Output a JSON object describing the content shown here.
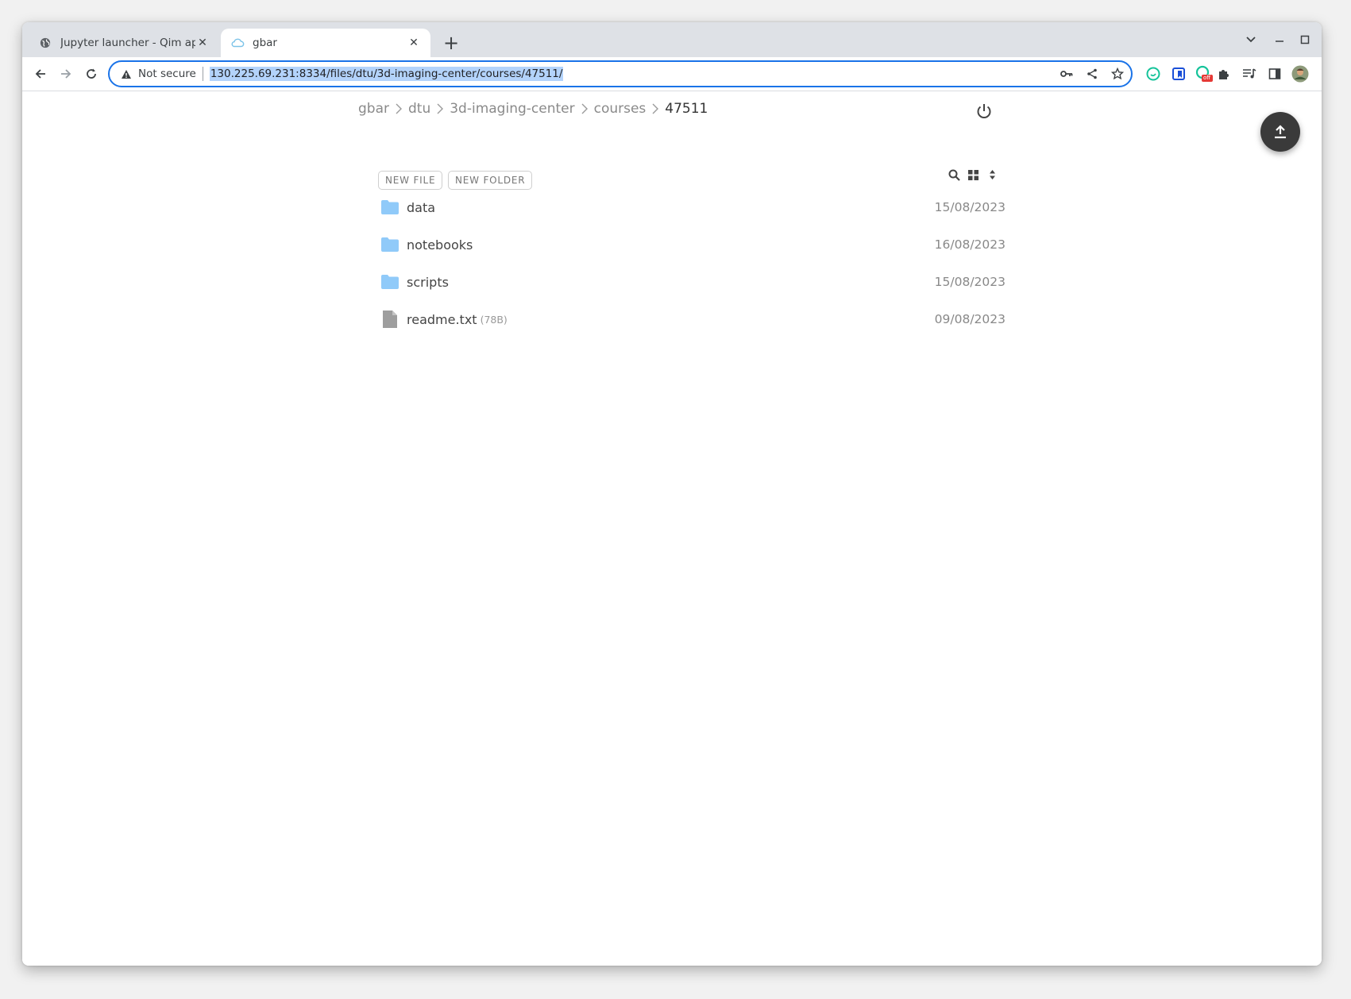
{
  "browser": {
    "tabs": [
      {
        "title": "Jupyter launcher - Qim app",
        "active": false,
        "favicon": "globe-icon"
      },
      {
        "title": "gbar",
        "active": true,
        "favicon": "cloud-icon"
      }
    ],
    "address": {
      "security_label": "Not secure",
      "url": "130.225.69.231:8334/files/dtu/3d-imaging-center/courses/47511/"
    },
    "extension_badge": "off"
  },
  "breadcrumb": [
    "gbar",
    "dtu",
    "3d-imaging-center",
    "courses",
    "47511"
  ],
  "actions": {
    "new_file": "NEW FILE",
    "new_folder": "NEW FOLDER"
  },
  "files": [
    {
      "name": "data",
      "type": "folder",
      "size": "",
      "date": "15/08/2023"
    },
    {
      "name": "notebooks",
      "type": "folder",
      "size": "",
      "date": "16/08/2023"
    },
    {
      "name": "scripts",
      "type": "folder",
      "size": "",
      "date": "15/08/2023"
    },
    {
      "name": "readme.txt",
      "type": "file",
      "size": "(78B)",
      "date": "09/08/2023"
    }
  ],
  "colors": {
    "folder": "#90caf9",
    "file": "#9e9e9e",
    "accent": "#1a73e8",
    "url_selection": "#b3d3fb",
    "fab": "#3a3a3a"
  }
}
